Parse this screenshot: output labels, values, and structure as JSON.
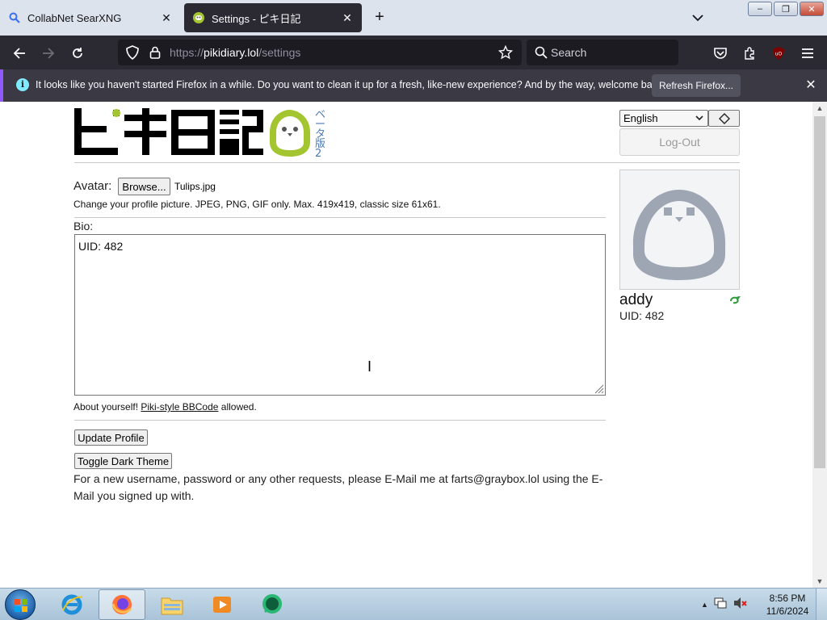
{
  "window": {
    "minimize_label": "‒",
    "maximize_label": "❐",
    "close_label": "✕"
  },
  "tabs": [
    {
      "title": "CollabNet SearXNG",
      "icon": "search-icon"
    },
    {
      "title": "Settings - ピキ日記",
      "icon": "piki-favicon"
    }
  ],
  "tabbar": {
    "new_tab": "+"
  },
  "navbar": {
    "url_prefix": "https://",
    "url_host": "pikidiary.lol",
    "url_path": "/settings",
    "search_placeholder": "Search"
  },
  "notification": {
    "text": "It looks like you haven't started Firefox in a while. Do you want to clean it up for a fresh, like-new experience? And by the way, welcome back!",
    "button": "Refresh Firefox...",
    "info_glyph": "i",
    "close_glyph": "✕"
  },
  "header": {
    "logo_text": "ピキ日記",
    "beta_text": [
      "ベ",
      "ー",
      "タ",
      "版",
      "2"
    ],
    "language": "English",
    "logout": "Log-Out"
  },
  "form": {
    "avatar_label": "Avatar:",
    "browse_button": "Browse...",
    "file_name": "Tulips.jpg",
    "avatar_help": "Change your profile picture. JPEG, PNG, GIF only. Max. 419x419, classic size 61x61.",
    "bio_label": "Bio:",
    "bio_value": "UID: 482",
    "bio_help_before": "About yourself! ",
    "bio_help_link": "Piki-style BBCode",
    "bio_help_after": " allowed.",
    "update_button": "Update Profile",
    "theme_button": "Toggle Dark Theme",
    "contact_text": "For a new username, password or any other requests, please E-Mail me at farts@graybox.lol using the E-Mail you signed up with."
  },
  "profile": {
    "username": "addy",
    "uid": "UID: 482"
  },
  "taskbar": {
    "time": "8:56 PM",
    "date": "11/6/2024",
    "apps": [
      "internet-explorer-icon",
      "firefox-icon",
      "file-explorer-icon",
      "media-player-icon",
      "chat-app-icon"
    ]
  },
  "colors": {
    "logo_green": "#a3c52f",
    "beta_blue": "#4a7ab8",
    "firefox_dark": "#2b2a33",
    "notification_accent": "#9059ff"
  }
}
